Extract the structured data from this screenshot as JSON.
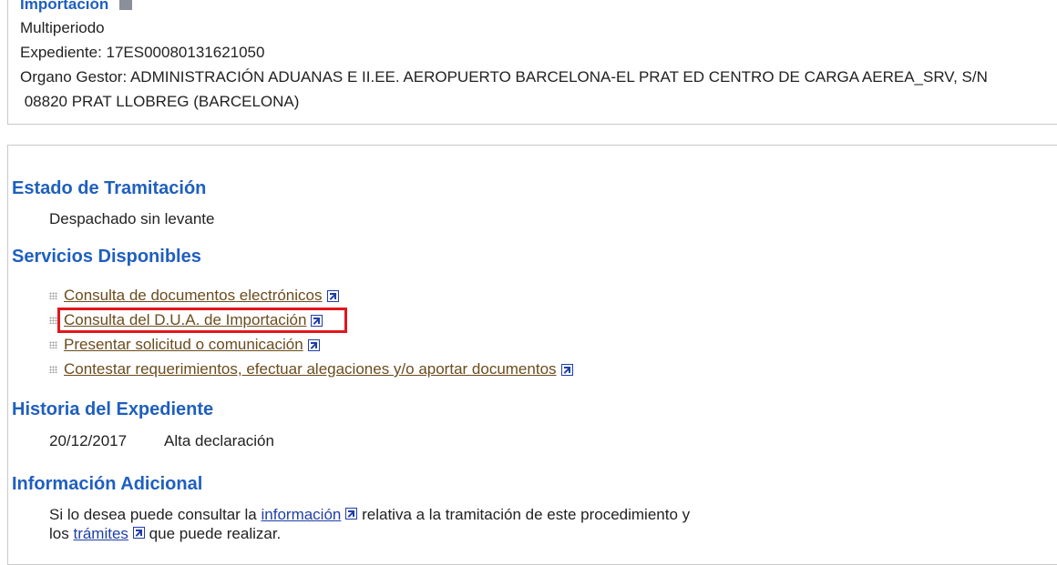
{
  "header": {
    "procedure_title": "Importación",
    "subtitle": "Multiperiodo",
    "expediente": "Expediente: 17ES00080131621050",
    "organo_line1": "Organo Gestor: ADMINISTRACIÓN ADUANAS E II.EE. AEROPUERTO BARCELONA-EL PRAT  ED CENTRO DE CARGA AEREA_SRV, S/N",
    "organo_line2": " 08820 PRAT LLOBREG (BARCELONA)"
  },
  "estado": {
    "title": "Estado de Tramitación",
    "value": "Despachado sin levante"
  },
  "servicios": {
    "title": "Servicios Disponibles",
    "items": [
      {
        "label": "Consulta de documentos electrónicos"
      },
      {
        "label": "Consulta del D.U.A. de Importación"
      },
      {
        "label": "Presentar solicitud o comunicación"
      },
      {
        "label": "Contestar requerimientos, efectuar alegaciones y/o aportar documentos"
      }
    ]
  },
  "historia": {
    "title": "Historia del Expediente",
    "rows": [
      {
        "date": "20/12/2017",
        "description": "Alta declaración"
      }
    ]
  },
  "info_adicional": {
    "title": "Información Adicional",
    "line1_prefix": "Si lo desea puede consultar la",
    "line1_link": "información",
    "line1_suffix": "relativa a la tramitación de este procedimiento y",
    "line2_prefix": "los",
    "line2_link": "trámites",
    "line2_suffix": "que puede realizar."
  },
  "colors": {
    "heading_blue": "#1f5fbf",
    "service_link": "#6b4c1d",
    "highlight_red": "#e3161d"
  }
}
